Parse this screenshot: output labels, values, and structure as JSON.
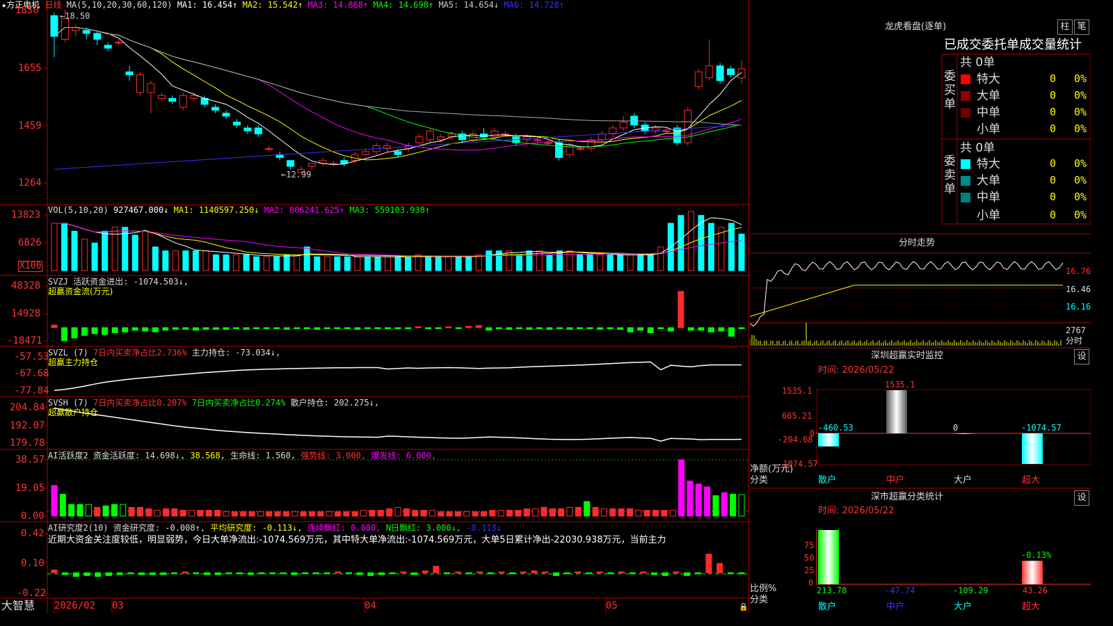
{
  "colors": {
    "up": "#ff2b2b",
    "down": "#00ffff",
    "ma1": "#ffffff",
    "ma2": "#ffff00",
    "ma3": "#ff00ff",
    "ma4": "#00ff00",
    "ma5": "#aaaaaa",
    "ma6": "#3333ff",
    "axis": "#b00000",
    "grid": "#7a0000"
  },
  "header": {
    "star": "★",
    "stock_name": "方正电机",
    "period": "日线",
    "ma_label": "MA(5,10,20,30,60,120)",
    "ma1": "MA1: 16.454↑",
    "ma2": "MA2: 15.542↑",
    "ma3": "MA3: 14.868↑",
    "ma4": "MA4: 14.698↑",
    "ma5": "MA5: 14.654↓",
    "ma6": "MA6: 14.728↑"
  },
  "price_panel": {
    "y_ticks": [
      "1850",
      "1655",
      "1459",
      "1264"
    ],
    "high_note": "←18.50",
    "low_note": "←12.99"
  },
  "vol_panel": {
    "title": "VOL(5,10,20)",
    "value": "927467.000↓",
    "ma1": "MA1: 1140597.250↓",
    "ma2": "MA2: 806241.625↑",
    "ma3": "MA3: 559103.938↑",
    "y_ticks": [
      "13823",
      "6826"
    ],
    "unit": "X100"
  },
  "svzj_panel": {
    "title": "SVZJ  活跃资金进出: -1074.503↓,",
    "subtitle": "超赢资金流(万元)",
    "y_ticks": [
      "48328",
      "14928",
      "-18471"
    ]
  },
  "svzl_panel": {
    "title": "SVZL (7)",
    "t1": "7日内买卖净占比2.736%",
    "t2": "主力持仓: -73.034↓,",
    "subtitle": "超赢主力持仓",
    "y_ticks": [
      "-57.53",
      "-67.68",
      "-77.84"
    ]
  },
  "svsh_panel": {
    "title": "SVSH (7)",
    "t1": "7日内买卖净占比0.207%",
    "t2": "7日内买卖净占比0.274%",
    "t3": "散户持仓: 202.275↓,",
    "subtitle": "超赢散户持仓",
    "y_ticks": [
      "204.84",
      "192.07",
      "179.78"
    ]
  },
  "ai_active": {
    "title": "AI活跃度2",
    "v1": "资金活跃度: 14.698↓,",
    "v2": "38.568,",
    "v3": "生命线: 1.560,",
    "v4": "强势线: 3.000,",
    "v5": "爆发线: 6.000,",
    "y_ticks": [
      "38.57",
      "19.05",
      "0.00"
    ]
  },
  "ai_research": {
    "title": "AI研究度2(10)",
    "v1": "资金研究度: -0.008↑,",
    "v2": "平均研究度: -0.113↓,",
    "v3": "连续飘红: 0.000,",
    "v4": "N日飘红: 3.000↓,",
    "v5": "-0.113↓",
    "comment": "近期大资金关注度较低，明显弱势，今日大单净流出:-1074.569万元，其中特大单净流出:-1074.569万元，大单5日累计净出-22030.938万元，当前主力",
    "y_ticks": [
      "0.42",
      "0.10",
      "-0.22"
    ]
  },
  "x_axis": {
    "brand": "大智慧",
    "labels": [
      "2026/02",
      "03",
      "04",
      "05"
    ]
  },
  "longhu": {
    "title": "龙虎看盘(逐单)",
    "btn_bar": "柱",
    "btn_pen": "笔",
    "tabs": "已成交委托单成交量统计",
    "buy_side": "委买单",
    "sell_side": "委卖单",
    "buy_total": "共 0单",
    "sell_total": "共 0单",
    "rows": [
      {
        "name": "特大",
        "count": "0",
        "pct": "0%"
      },
      {
        "name": "大单",
        "count": "0",
        "pct": "0%"
      },
      {
        "name": "中单",
        "count": "0",
        "pct": "0%"
      },
      {
        "name": "小单",
        "count": "0",
        "pct": "0%"
      }
    ]
  },
  "intraday": {
    "title": "分时走势",
    "y_ticks": [
      "16.76",
      "16.46",
      "16.16"
    ],
    "vol": "2767",
    "unit": "分时"
  },
  "sz_monitor": {
    "title": "深圳超赢实时监控",
    "btn": "设",
    "time": "时间: 2026/05/22",
    "y_ticks": [
      "1535.1",
      "665.21",
      "0",
      "-204.68",
      "-1074.57"
    ],
    "side_label": "净额(万元)",
    "cat_label": "分类",
    "categories": [
      "散户",
      "中户",
      "大户",
      "超大"
    ],
    "values": [
      "-460.53",
      "1535.1",
      "0",
      "-1074.57"
    ]
  },
  "sz_class": {
    "title": "深市超赢分类统计",
    "btn": "设",
    "time": "时间: 2026/05/22",
    "y_ticks": [
      "75",
      "50",
      "25",
      "0"
    ],
    "side_label": "比例%",
    "cat_label": "分类",
    "categories": [
      "散户",
      "中户",
      "大户",
      "超大"
    ],
    "values": [
      "213.78",
      "-47.74",
      "-109.29",
      "43.26"
    ],
    "top_note": "-0.13%"
  },
  "chart_data": [
    {
      "type": "candlestick",
      "title": "方正电机 日线",
      "price_ticks": [
        18.5,
        16.55,
        14.59,
        12.64
      ],
      "ylim": [
        12.64,
        18.5
      ],
      "high": 18.5,
      "low": 12.99,
      "candles": [
        [
          18.3,
          17.6,
          18.4,
          16.9
        ],
        [
          17.5,
          18.2,
          18.5,
          17.4
        ],
        [
          17.8,
          17.9,
          18.0,
          17.6
        ],
        [
          17.8,
          17.7,
          17.9,
          17.5
        ],
        [
          17.7,
          17.5,
          17.8,
          17.3
        ],
        [
          17.3,
          17.2,
          17.4,
          17.1
        ],
        [
          17.4,
          17.4,
          17.5,
          17.3
        ],
        [
          16.4,
          16.3,
          16.6,
          16.1
        ],
        [
          15.7,
          16.3,
          16.4,
          15.6
        ],
        [
          15.7,
          16.0,
          16.1,
          15.0
        ],
        [
          15.5,
          15.6,
          15.7,
          15.4
        ],
        [
          15.5,
          15.4,
          15.6,
          15.3
        ],
        [
          15.2,
          15.6,
          15.7,
          15.1
        ],
        [
          15.5,
          15.6,
          15.7,
          15.4
        ],
        [
          15.5,
          15.3,
          15.6,
          15.2
        ],
        [
          15.2,
          15.1,
          15.3,
          15.0
        ],
        [
          15.0,
          14.9,
          15.1,
          14.8
        ],
        [
          14.7,
          14.6,
          14.8,
          14.5
        ],
        [
          14.5,
          14.4,
          14.6,
          14.3
        ],
        [
          14.5,
          14.3,
          14.6,
          14.2
        ],
        [
          13.8,
          13.8,
          13.9,
          13.7
        ],
        [
          13.6,
          13.5,
          13.7,
          13.4
        ],
        [
          13.4,
          13.2,
          13.4,
          13.1
        ],
        [
          13.0,
          13.1,
          13.2,
          12.99
        ],
        [
          13.2,
          13.3,
          13.3,
          13.1
        ],
        [
          13.3,
          13.4,
          13.5,
          13.2
        ],
        [
          13.3,
          13.3,
          13.4,
          13.2
        ],
        [
          13.4,
          13.3,
          13.5,
          13.2
        ],
        [
          13.4,
          13.6,
          13.7,
          13.3
        ],
        [
          13.6,
          13.7,
          13.8,
          13.5
        ],
        [
          13.7,
          13.9,
          14.0,
          13.6
        ],
        [
          13.8,
          13.9,
          14.0,
          13.7
        ],
        [
          13.7,
          13.6,
          13.8,
          13.5
        ],
        [
          13.8,
          13.9,
          14.0,
          13.7
        ],
        [
          14.0,
          14.2,
          14.3,
          13.9
        ],
        [
          14.1,
          14.4,
          14.5,
          14.0
        ],
        [
          14.1,
          14.2,
          14.3,
          14.0
        ],
        [
          14.2,
          14.3,
          14.4,
          14.1
        ],
        [
          14.3,
          14.1,
          14.4,
          14.0
        ],
        [
          14.1,
          14.3,
          14.4,
          14.0
        ],
        [
          14.3,
          14.2,
          14.5,
          14.1
        ],
        [
          14.2,
          14.4,
          14.5,
          14.1
        ],
        [
          14.3,
          14.3,
          14.4,
          14.2
        ],
        [
          14.2,
          14.0,
          14.3,
          13.9
        ],
        [
          14.1,
          14.2,
          14.3,
          14.0
        ],
        [
          14.1,
          14.1,
          14.2,
          14.0
        ],
        [
          14.0,
          14.0,
          14.1,
          13.9
        ],
        [
          14.0,
          13.5,
          14.1,
          13.4
        ],
        [
          13.6,
          13.9,
          14.0,
          13.5
        ],
        [
          13.8,
          13.8,
          13.9,
          13.7
        ],
        [
          13.8,
          14.1,
          14.2,
          13.7
        ],
        [
          14.1,
          14.3,
          14.4,
          14.0
        ],
        [
          14.3,
          14.5,
          14.6,
          14.2
        ],
        [
          14.5,
          14.7,
          14.9,
          14.4
        ],
        [
          14.9,
          14.6,
          15.0,
          14.5
        ],
        [
          14.6,
          14.4,
          14.7,
          14.3
        ],
        [
          14.4,
          14.5,
          14.6,
          14.3
        ],
        [
          14.4,
          14.4,
          14.5,
          14.3
        ],
        [
          14.5,
          14.0,
          14.6,
          13.9
        ],
        [
          14.0,
          15.1,
          15.2,
          13.9
        ],
        [
          15.9,
          16.4,
          16.5,
          15.8
        ],
        [
          16.2,
          16.6,
          17.5,
          16.1
        ],
        [
          16.6,
          16.1,
          16.7,
          16.0
        ],
        [
          16.5,
          16.3,
          16.6,
          16.2
        ],
        [
          16.2,
          16.5,
          16.8,
          16.0
        ]
      ]
    },
    {
      "type": "bar",
      "title": "VOL(5,10,20)",
      "y_ticks": [
        13823,
        6826
      ],
      "unit": "X100",
      "values": [
        12,
        12,
        10,
        8,
        7,
        10,
        11,
        11,
        9,
        10,
        6,
        5,
        5,
        5,
        5,
        5,
        4,
        4,
        4,
        4,
        3.5,
        3.5,
        3.5,
        4,
        4,
        6,
        3.5,
        3.5,
        3.5,
        3.5,
        3.5,
        3.5,
        3.5,
        3.5,
        3.5,
        3.5,
        4,
        3.5,
        3.5,
        3.5,
        3.5,
        3.5,
        4,
        5,
        5,
        5,
        4,
        5,
        5,
        4,
        5,
        5,
        4,
        4,
        4,
        4,
        4,
        4,
        4,
        4,
        6,
        12,
        14,
        15,
        14,
        12,
        11,
        12,
        9.27
      ]
    },
    {
      "type": "bar",
      "title": "超赢资金流(万元)",
      "y_ticks": [
        48328,
        14928,
        -18471
      ],
      "values": [
        3000,
        -15000,
        -12000,
        -9000,
        -7000,
        -8000,
        -6000,
        -5000,
        -3000,
        -4000,
        -5000,
        -3000,
        -2000,
        -2000,
        -3000,
        -2000,
        -2000,
        -2000,
        -1000,
        -2000,
        -1000,
        -1000,
        -1000,
        -2000,
        -1000,
        -1000,
        -2000,
        -1000,
        -1000,
        -1000,
        -2000,
        -1000,
        -1000,
        -1000,
        -1000,
        -1000,
        1000,
        -1000,
        -1000,
        1000,
        -1000,
        1500,
        2500,
        -3000,
        -1000,
        -2000,
        -1000,
        -2000,
        -1000,
        -2000,
        -1000,
        -2000,
        -1000,
        -1000,
        -2000,
        -1000,
        -2000,
        -5000,
        -3000,
        -6000,
        -1000,
        -4000,
        42000,
        -3000,
        -3000,
        -5000,
        -4000,
        -10000,
        -1074
      ]
    },
    {
      "type": "line",
      "title": "超赢主力持仓",
      "y_ticks": [
        -57.53,
        -67.68,
        -77.84
      ],
      "values": [
        -57.8,
        -58.4,
        -59.3,
        -60.4,
        -61.6,
        -62.7,
        -63.5,
        -64.2,
        -64.9,
        -65.4,
        -65.9,
        -66.5,
        -67.0,
        -67.5,
        -68.0,
        -68.5,
        -68.9,
        -69.3,
        -69.7,
        -70.0,
        -70.2,
        -70.5,
        -70.6,
        -70.8,
        -70.9,
        -71.0,
        -71.1,
        -71.2,
        -71.3,
        -71.3,
        -71.4,
        -71.4,
        -71.4,
        -70.6,
        -70.9,
        -71.2,
        -71.0,
        -71.2,
        -71.3,
        -71.4,
        -71.3,
        -71.1,
        -70.9,
        -71.1,
        -71.2,
        -71.3,
        -71.6,
        -71.9,
        -72.1,
        -72.3,
        -72.5,
        -72.7,
        -72.9,
        -73.2,
        -73.5,
        -73.8,
        -74.1,
        -74.4,
        -74.6,
        -74.8,
        -70.1,
        -72.8,
        -72.3,
        -71.9,
        -72.6,
        -73.0,
        -73.0,
        -73.0,
        -73.034
      ]
    },
    {
      "type": "line",
      "title": "超赢散户持仓",
      "y_ticks": [
        204.84,
        192.07,
        179.78
      ],
      "values": [
        180.5,
        182.0,
        183.0,
        184.0,
        185.0,
        186.0,
        187.0,
        188.0,
        189.0,
        190.0,
        191.0,
        192.0,
        193.0,
        193.8,
        194.5,
        195.2,
        195.9,
        196.5,
        197.0,
        197.5,
        197.9,
        198.3,
        198.6,
        199.0,
        199.3,
        199.6,
        199.9,
        200.1,
        200.3,
        200.5,
        200.6,
        200.7,
        200.8,
        200.0,
        200.2,
        200.5,
        200.8,
        201.0,
        201.2,
        201.4,
        201.5,
        201.3,
        201.0,
        200.6,
        200.8,
        201.0,
        201.3,
        201.6,
        201.9,
        202.2,
        202.3,
        202.4,
        202.3,
        202.1,
        201.8,
        201.5,
        201.2,
        201.0,
        201.3,
        201.5,
        203.5,
        201.6,
        201.8,
        202.0,
        202.5,
        202.3,
        202.3,
        202.3,
        202.275
      ]
    },
    {
      "type": "bar",
      "title": "AI活跃度2",
      "y_ticks": [
        38.57,
        19.05,
        0.0
      ],
      "values": [
        21,
        15,
        8,
        8,
        8,
        6,
        7,
        8,
        8,
        6,
        6,
        5,
        4,
        5,
        5,
        4,
        4,
        4,
        4,
        4,
        3,
        3,
        3,
        3,
        3,
        3,
        3,
        3,
        3,
        3,
        3,
        3,
        3,
        3,
        3,
        3,
        4,
        4,
        4,
        5,
        6,
        5,
        4,
        4,
        4,
        3,
        3,
        3,
        3,
        3,
        3,
        4,
        4,
        4,
        4,
        5,
        5,
        6,
        5,
        5,
        6,
        6,
        10,
        6,
        5,
        5,
        5,
        5,
        4,
        4,
        4,
        4,
        4,
        38.57,
        24,
        22,
        20,
        14,
        16,
        15,
        14.7
      ]
    },
    {
      "type": "bar",
      "title": "AI研究度2(10)",
      "y_ticks": [
        0.42,
        0.1,
        -0.22
      ],
      "values": [
        0.03,
        -0.02,
        -0.04,
        -0.03,
        -0.04,
        -0.03,
        -0.02,
        -0.01,
        -0.02,
        -0.02,
        -0.02,
        -0.01,
        0.01,
        -0.01,
        -0.02,
        -0.02,
        -0.01,
        -0.01,
        -0.02,
        -0.01,
        -0.01,
        -0.01,
        -0.02,
        -0.01,
        -0.01,
        -0.01,
        0.01,
        -0.01,
        -0.02,
        -0.03,
        -0.02,
        -0.01,
        0.01,
        -0.02,
        0.02,
        0.07,
        -0.01,
        0.01,
        -0.01,
        0.01,
        -0.01,
        0.01,
        -0.01,
        0.01,
        0.02,
        0.01,
        -0.03,
        -0.01,
        0.01,
        -0.01,
        0.01,
        -0.01,
        0.01,
        -0.01,
        0.01,
        -0.02,
        -0.03,
        0.01,
        -0.03,
        -0.01,
        0.2,
        0.1,
        -0.01,
        -0.008
      ]
    }
  ]
}
